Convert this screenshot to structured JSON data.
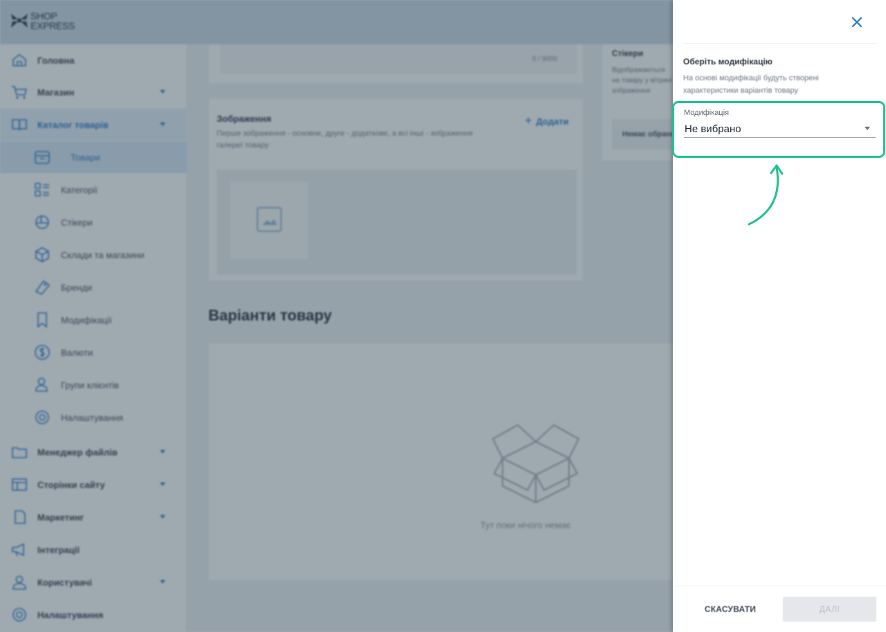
{
  "logo": {
    "text_line1": "SHOP",
    "text_line2": "EXPRESS"
  },
  "sidebar": {
    "items": [
      {
        "label": "Головна",
        "icon": "home-icon",
        "has_caret": false
      },
      {
        "label": "Магазин",
        "icon": "cart-icon",
        "has_caret": true
      },
      {
        "label": "Каталог товарів",
        "icon": "book-icon",
        "has_caret": true,
        "expanded": true
      },
      {
        "label": "Товари",
        "icon": "box-icon",
        "sub": true,
        "active": true
      },
      {
        "label": "Категорії",
        "icon": "list-icon",
        "sub": true
      },
      {
        "label": "Стікери",
        "icon": "sticker-icon",
        "sub": true
      },
      {
        "label": "Склади та магазини",
        "icon": "package-icon",
        "sub": true
      },
      {
        "label": "Бренди",
        "icon": "tag-icon",
        "sub": true
      },
      {
        "label": "Модифікації",
        "icon": "bookmark-icon",
        "sub": true
      },
      {
        "label": "Валюти",
        "icon": "dollar-icon",
        "sub": true
      },
      {
        "label": "Групи клієнтів",
        "icon": "user-group-icon",
        "sub": true
      },
      {
        "label": "Налаштування",
        "icon": "gear-icon",
        "sub": true
      },
      {
        "label": "Менеджер файлів",
        "icon": "folder-icon",
        "has_caret": true
      },
      {
        "label": "Сторінки сайту",
        "icon": "layout-icon",
        "has_caret": true
      },
      {
        "label": "Маркетинг",
        "icon": "marketing-icon",
        "has_caret": true
      },
      {
        "label": "Інтеграції",
        "icon": "megaphone-icon",
        "has_caret": false
      },
      {
        "label": "Користувачі",
        "icon": "user-icon",
        "has_caret": true
      },
      {
        "label": "Налаштування",
        "icon": "gear-icon",
        "has_caret": false
      }
    ]
  },
  "main": {
    "description_counter": "0 / 9000",
    "images": {
      "title": "Зображення",
      "description": "Перше зображення - основне, друге - додаткове, а всі інші - зображення галереї товару",
      "add_label": "Додати"
    },
    "stickers": {
      "title": "Стікери",
      "description": "Відображаються на товару у вітрині зображення",
      "button_label": "Немає обраних"
    },
    "variants": {
      "heading": "Варіанти товару",
      "empty_text": "Тут поки нічого немає"
    }
  },
  "drawer": {
    "title": "Оберіть модифікацію",
    "description": "На основі модифікації будуть створені характеристики варіантів товару",
    "field_label": "Модифікація",
    "select_value": "Не вибрано",
    "cancel_label": "СКАСУВАТИ",
    "next_label": "ДАЛІ"
  },
  "colors": {
    "accent": "#1f75c6",
    "highlight": "#1fc38f"
  }
}
